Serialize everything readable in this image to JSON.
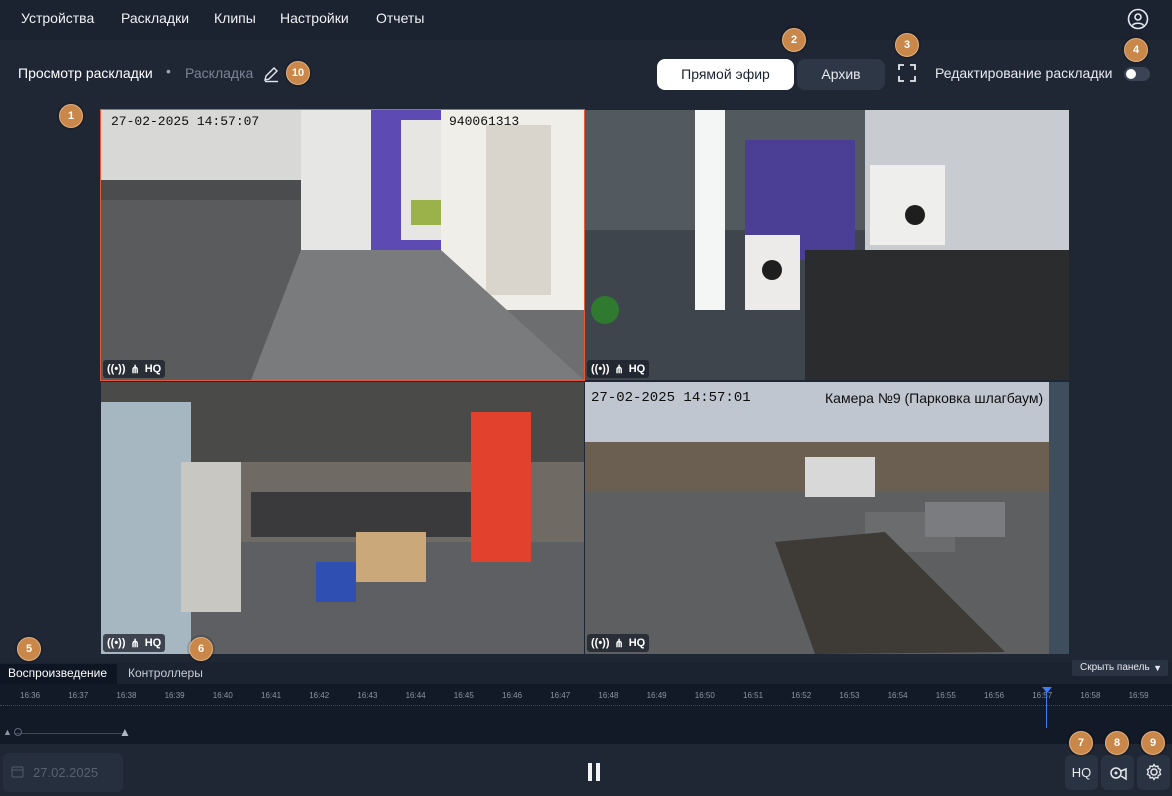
{
  "nav": {
    "items": [
      "Устройства",
      "Раскладки",
      "Клипы",
      "Настройки",
      "Отчеты"
    ]
  },
  "breadcrumb": {
    "main": "Просмотр раскладки",
    "separator": "•",
    "sub": "Раскладка"
  },
  "toolbar": {
    "live_label": "Прямой эфир",
    "archive_label": "Архив",
    "edit_layout_label": "Редактирование раскладки",
    "edit_layout_enabled": false
  },
  "annotations": [
    "1",
    "2",
    "3",
    "4",
    "5",
    "6",
    "7",
    "8",
    "9",
    "10"
  ],
  "cameras": [
    {
      "timestamp": "27-02-2025 14:57:07",
      "id": "940061313",
      "quality": "HQ"
    },
    {
      "timestamp": "",
      "id": "",
      "quality": "HQ"
    },
    {
      "timestamp": "",
      "id": "",
      "quality": "HQ"
    },
    {
      "timestamp": "27-02-2025 14:57:01",
      "id": "Камера №9 (Парковка шлагбаум)",
      "quality": "HQ"
    }
  ],
  "panel": {
    "tab_playback": "Воспроизведение",
    "tab_controllers": "Контроллеры",
    "hide_panel": "Скрыть панель"
  },
  "timeline": {
    "ticks": [
      "16:36",
      "16:37",
      "16:38",
      "16:39",
      "16:40",
      "16:41",
      "16:42",
      "16:43",
      "16:44",
      "16:45",
      "16:46",
      "16:47",
      "16:48",
      "16:49",
      "16:50",
      "16:51",
      "16:52",
      "16:53",
      "16:54",
      "16:55",
      "16:56",
      "16:57",
      "16:58",
      "16:59"
    ]
  },
  "controls": {
    "date": "27.02.2025",
    "quality_label": "HQ"
  },
  "colors": {
    "accent": "#3a7dff",
    "badge": "#c9874a",
    "selection": "#e45a3b"
  }
}
